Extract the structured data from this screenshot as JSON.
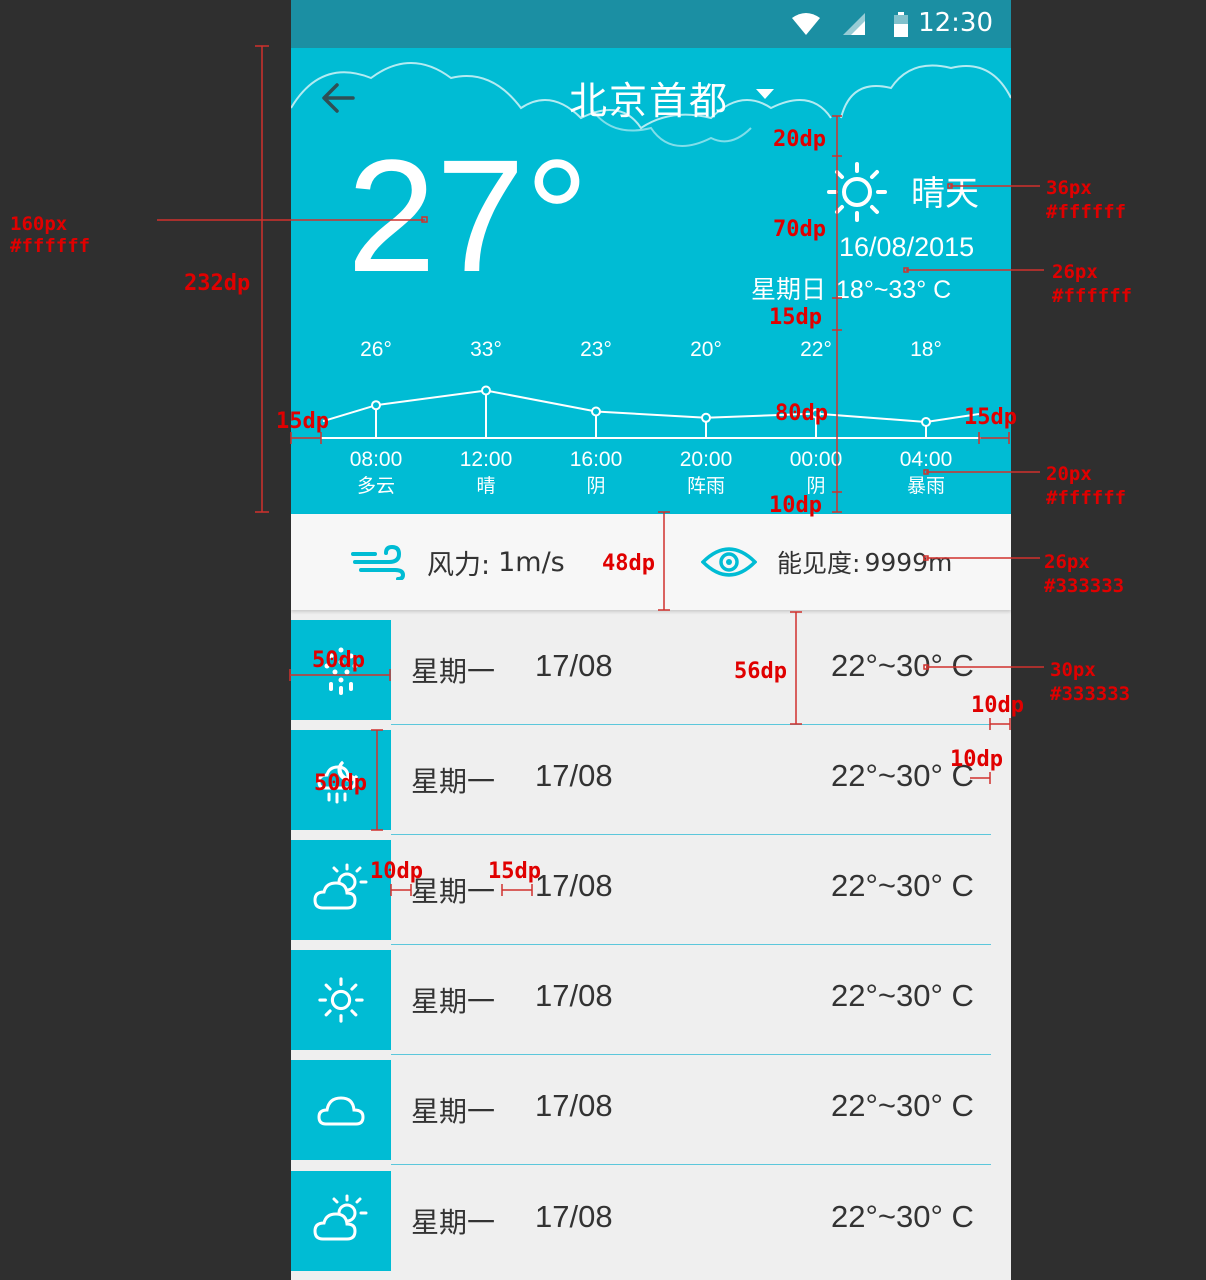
{
  "status_bar": {
    "time": "12:30"
  },
  "header": {
    "city": "北京首都"
  },
  "current": {
    "temp": "27°",
    "condition": "晴天",
    "date": "16/08/2015",
    "weekday": "星期日",
    "range": "18°~33° C"
  },
  "hourly": [
    {
      "temp": "26°",
      "value": 26,
      "time": "08:00",
      "cond": "多云"
    },
    {
      "temp": "33°",
      "value": 33,
      "time": "12:00",
      "cond": "晴"
    },
    {
      "temp": "23°",
      "value": 23,
      "time": "16:00",
      "cond": "阴"
    },
    {
      "temp": "20°",
      "value": 20,
      "time": "20:00",
      "cond": "阵雨"
    },
    {
      "temp": "22°",
      "value": 22,
      "time": "00:00",
      "cond": "阴"
    },
    {
      "temp": "18°",
      "value": 18,
      "time": "04:00",
      "cond": "暴雨"
    }
  ],
  "info": {
    "wind_label": "风力:",
    "wind_value": "1m/s",
    "visibility_label": "能见度:",
    "visibility_value": "9999m"
  },
  "forecast": [
    {
      "icon": "snow-rain-icon",
      "day": "星期一",
      "date": "17/08",
      "range": "22°~30° C"
    },
    {
      "icon": "cloud-moon-rain-icon",
      "day": "星期一",
      "date": "17/08",
      "range": "22°~30° C"
    },
    {
      "icon": "cloud-sun-icon",
      "day": "星期一",
      "date": "17/08",
      "range": "22°~30° C"
    },
    {
      "icon": "sun-icon",
      "day": "星期一",
      "date": "17/08",
      "range": "22°~30° C"
    },
    {
      "icon": "cloud-icon",
      "day": "星期一",
      "date": "17/08",
      "range": "22°~30° C"
    },
    {
      "icon": "cloud-sun-icon",
      "day": "星期一",
      "date": "17/08",
      "range": "22°~30° C"
    }
  ],
  "annotations": {
    "dp232": "232dp",
    "px160": "160px",
    "white1": "#ffffff",
    "dp20": "20dp",
    "dp70": "70dp",
    "dp15a": "15dp",
    "dp80": "80dp",
    "dp10a": "10dp",
    "px36": "36px",
    "white2": "#ffffff",
    "px26": "26px",
    "white3": "#ffffff",
    "px20": "20px",
    "white4": "#ffffff",
    "dp15b": "15dp",
    "dp15c": "15dp",
    "dp48": "48dp",
    "px26b": "26px",
    "grey1": "#333333",
    "dp50a": "50dp",
    "dp56": "56dp",
    "px30": "30px",
    "grey2": "#333333",
    "dp10b": "10dp",
    "dp50b": "50dp",
    "dp10c": "10dp",
    "dp10d": "10dp",
    "dp15d": "15dp"
  },
  "colors": {
    "accent": "#00bcd4",
    "status_bar": "#1b8fa3",
    "list_bg": "#efefef",
    "text_dark": "#333333",
    "annotation": "#e00000"
  }
}
